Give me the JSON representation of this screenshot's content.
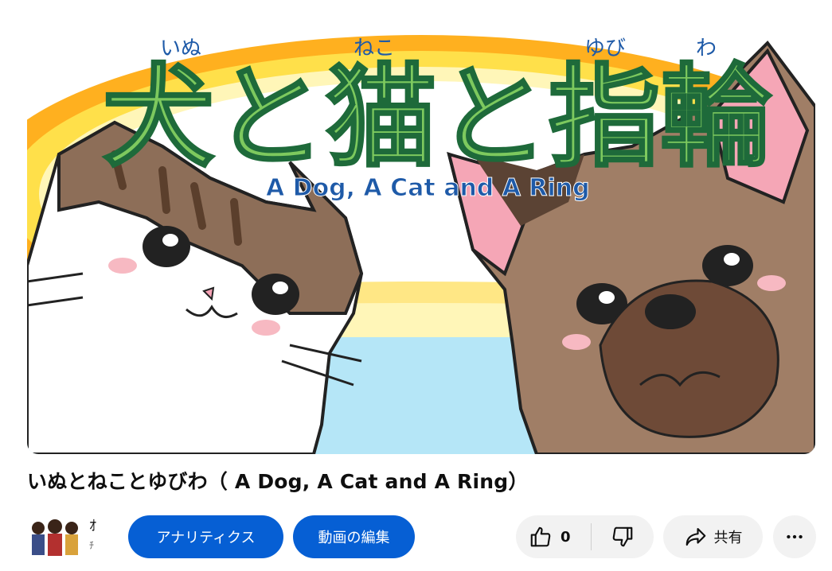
{
  "video": {
    "title": "いぬとねことゆびわ（ A Dog, A Cat and A Ring）",
    "thumbnail": {
      "heading": "犬と猫と指輪",
      "ruby_inu": "いぬ",
      "ruby_neko": "ねこ",
      "ruby_yubiwa_1": "ゆび",
      "ruby_yubiwa_2": "わ",
      "subtitle": "A Dog, A Cat and A Ring"
    }
  },
  "channel": {
    "name_partial": "ｵ",
    "sub_partial": "ﾁ"
  },
  "actions": {
    "analytics_label": "アナリティクス",
    "edit_label": "動画の編集",
    "like_count": "0",
    "share_label": "共有"
  },
  "icons": {
    "like": "thumbs-up-icon",
    "dislike": "thumbs-down-icon",
    "share": "share-arrow-icon",
    "more": "more-horizontal-icon"
  },
  "colors": {
    "primary_button": "#065fd4",
    "secondary_button": "#f2f2f2",
    "title_green": "#7dc95e",
    "ruby_blue": "#1e5aa8"
  }
}
